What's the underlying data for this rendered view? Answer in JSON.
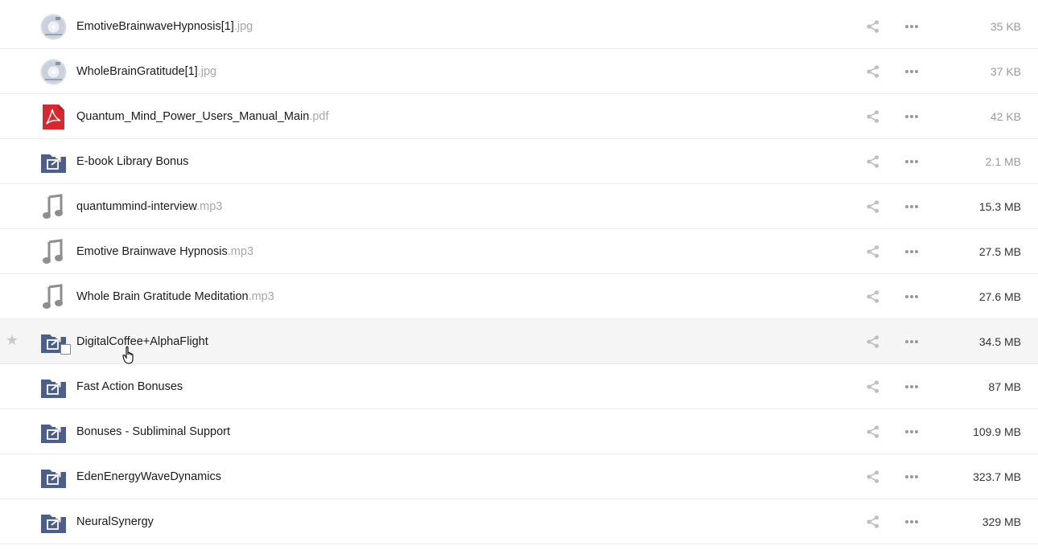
{
  "files": [
    {
      "name": "EmotiveBrainwaveHypnosis[1]",
      "ext": ".jpg",
      "size": "35 KB",
      "icon": "image-thumbnail-icon",
      "size_color": "#9a9a9a"
    },
    {
      "name": "WholeBrainGratitude[1]",
      "ext": ".jpg",
      "size": "37 KB",
      "icon": "image-thumbnail-icon",
      "size_color": "#9a9a9a"
    },
    {
      "name": "Quantum_Mind_Power_Users_Manual_Main",
      "ext": ".pdf",
      "size": "42 KB",
      "icon": "pdf-icon",
      "size_color": "#9a9a9a"
    },
    {
      "name": "E-book Library Bonus",
      "ext": "",
      "size": "2.1 MB",
      "icon": "shared-folder-icon",
      "size_color": "#9a9a9a"
    },
    {
      "name": "quantummind-interview",
      "ext": ".mp3",
      "size": "15.3 MB",
      "icon": "audio-file-icon",
      "size_color": "#333333"
    },
    {
      "name": "Emotive Brainwave Hypnosis",
      "ext": ".mp3",
      "size": "27.5 MB",
      "icon": "audio-file-icon",
      "size_color": "#333333"
    },
    {
      "name": "Whole Brain Gratitude Meditation",
      "ext": ".mp3",
      "size": "27.6 MB",
      "icon": "audio-file-icon",
      "size_color": "#333333"
    },
    {
      "name": "DigitalCoffee+AlphaFlight",
      "ext": "",
      "size": "34.5 MB",
      "icon": "shared-folder-icon",
      "size_color": "#333333"
    },
    {
      "name": "Fast Action Bonuses",
      "ext": "",
      "size": "87 MB",
      "icon": "shared-folder-icon",
      "size_color": "#333333"
    },
    {
      "name": "Bonuses - Subliminal Support",
      "ext": "",
      "size": "109.9 MB",
      "icon": "shared-folder-icon",
      "size_color": "#333333"
    },
    {
      "name": "EdenEnergyWaveDynamics",
      "ext": "",
      "size": "323.7 MB",
      "icon": "shared-folder-icon",
      "size_color": "#333333"
    },
    {
      "name": "NeuralSynergy",
      "ext": "",
      "size": "329 MB",
      "icon": "shared-folder-icon",
      "size_color": "#333333"
    }
  ],
  "hovered_index": 7,
  "colors": {
    "folder": "#4a5f8c",
    "pdf": "#d7282f",
    "audio": "#8e8e8e",
    "action_icon": "#c0c0c0"
  }
}
